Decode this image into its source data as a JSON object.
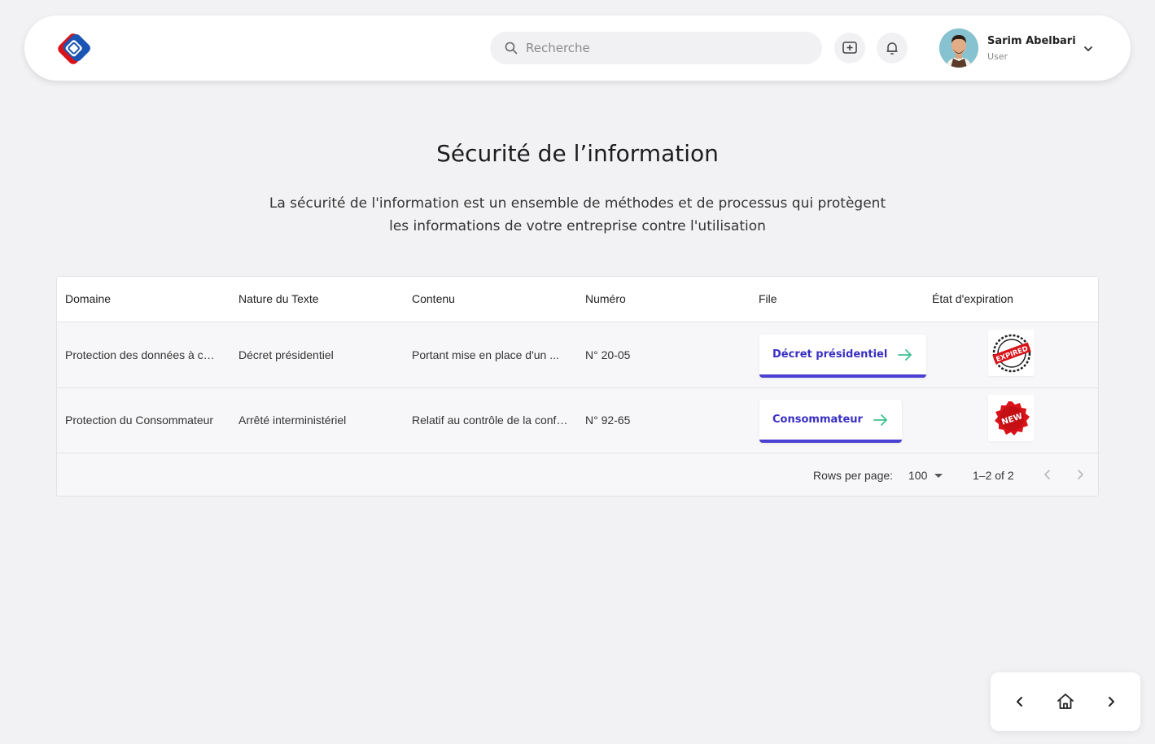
{
  "header": {
    "search_placeholder": "Recherche",
    "user": {
      "name": "Sarim Abelbari",
      "role": "User"
    }
  },
  "page": {
    "title": "Sécurité de l’information",
    "description": "La sécurité de l'information est un ensemble de méthodes et de processus qui protègent les informations de votre entreprise contre l'utilisation"
  },
  "table": {
    "columns": [
      "Domaine",
      "Nature du Texte",
      "Contenu",
      "Numéro",
      "File",
      "État d'expiration"
    ],
    "rows": [
      {
        "domaine": "Protection des données à caractère personnel",
        "nature": "Décret présidentiel",
        "contenu": "Portant mise en place d'un ...",
        "numero": "N° 20-05",
        "file": "Décret présidentiel",
        "etat": "EXPIRED"
      },
      {
        "domaine": "Protection du Consommateur",
        "nature": "Arrêté interministériel",
        "contenu": "Relatif au contrôle de la conformité",
        "numero": "N° 92-65",
        "file": "Consommateur",
        "etat": "NEW"
      }
    ]
  },
  "pagination": {
    "rows_per_page_label": "Rows per page:",
    "rows_per_page": "100",
    "range": "1–2 of 2"
  },
  "colors": {
    "accent": "#4a3fd1",
    "arrow": "#3ec28f",
    "badge_red": "#d8141a"
  },
  "icons": [
    "search-icon",
    "add-box-icon",
    "bell-icon",
    "chevron-down-icon",
    "arrow-right-icon",
    "chevron-left-icon",
    "chevron-right-icon",
    "home-icon"
  ]
}
